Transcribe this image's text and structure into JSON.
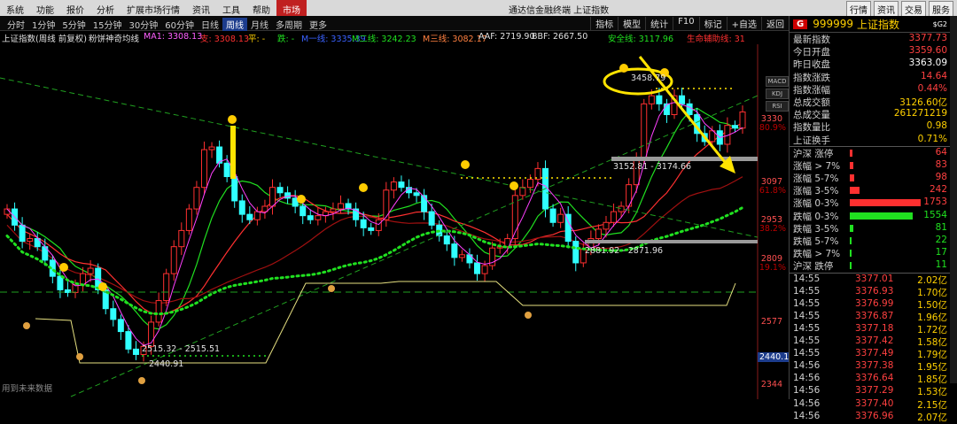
{
  "topbar": {
    "menu": [
      "系统",
      "功能",
      "报价",
      "分析",
      "扩展市场行情",
      "资讯",
      "工具",
      "帮助",
      "市场"
    ],
    "app_title": "通达信金融终端  上证指数",
    "right_buttons": [
      "行情",
      "资讯",
      "交易",
      "服务"
    ]
  },
  "periodbar": {
    "periods": [
      "分时",
      "1分钟",
      "5分钟",
      "15分钟",
      "30分钟",
      "60分钟",
      "日线",
      "周线",
      "月线",
      "多周期",
      "更多"
    ],
    "selected": "周线",
    "tools": [
      "指标",
      "模型",
      "统计",
      "F10",
      "标记",
      "+自选",
      "返回"
    ]
  },
  "indicators": {
    "title": "上证指数(周线 前复权)",
    "formula": "粉饼神奇均线",
    "ma1": "MA1: 3308.13",
    "items": [
      {
        "text": "支: 3308.13",
        "color": "#ff3030"
      },
      {
        "text": "平: -",
        "color": "#ffd000"
      },
      {
        "text": "跌: -",
        "color": "#20e020"
      },
      {
        "text": "M一线: 3335.39",
        "color": "#3a62ff"
      },
      {
        "text": "M二线: 3242.23",
        "color": "#20e020"
      },
      {
        "text": "M三线: 3082.17",
        "color": "#ff8040"
      },
      {
        "text": "AAF: 2719.90",
        "color": "#e0e0e0"
      },
      {
        "text": "BBF: 2667.50",
        "color": "#e0e0e0"
      },
      {
        "text": "安全线: 3117.96",
        "color": "#20e020"
      },
      {
        "text": "生命辅助线: 31",
        "color": "#ff3030"
      }
    ]
  },
  "chart_data": {
    "type": "candlestick",
    "symbol": "999999 上证指数",
    "period": "周线",
    "y_axis_labels": [
      "3330",
      "3097",
      "2953",
      "2809",
      "2577",
      "2344"
    ],
    "y_axis_percents": [
      "80.9%",
      "61.8%",
      "38.2%",
      "19.1%"
    ],
    "price_range": [
      2340,
      3460
    ],
    "last_price_tag": "2440.1",
    "annotations": {
      "high": "3458.79",
      "low": "2440.91",
      "zone_high": "3152.81 - 3174.66",
      "zone_mid": "2881.92 - 2871.96",
      "zone_low": "2515.32 - 2515.51"
    },
    "weekly_closes": [
      3000,
      2940,
      2880,
      2890,
      2860,
      2810,
      2750,
      2700,
      2690,
      2720,
      2760,
      2780,
      2700,
      2630,
      2590,
      2545,
      2480,
      2460,
      2490,
      2580,
      2660,
      2760,
      2860,
      2920,
      3000,
      3080,
      3220,
      3230,
      3170,
      3120,
      3030,
      2980,
      2960,
      2990,
      3010,
      3080,
      3060,
      3040,
      3010,
      2975,
      2960,
      2975,
      2990,
      3000,
      3020,
      3000,
      2960,
      2930,
      2920,
      2960,
      3070,
      3100,
      3080,
      3060,
      3050,
      2990,
      2940,
      2900,
      2870,
      2820,
      2830,
      2800,
      2760,
      2790,
      2855,
      2860,
      2890,
      3050,
      3080,
      3110,
      3150,
      3000,
      2950,
      2980,
      2880,
      2800,
      2850,
      2890,
      2925,
      2950,
      2990,
      3010,
      3090,
      3180,
      3390,
      3420,
      3390,
      3350,
      3420,
      3390,
      3350,
      3280,
      3250,
      3290,
      3240,
      3310,
      3300,
      3360
    ]
  },
  "footer_note": "用到未来数据",
  "quote": {
    "code": "999999",
    "name": "上证指数",
    "tag": "$G2",
    "fields": [
      {
        "label": "最新指数",
        "value": "3377.73",
        "color": "red"
      },
      {
        "label": "今日开盘",
        "value": "3359.60",
        "color": "red"
      },
      {
        "label": "昨日收盘",
        "value": "3363.09",
        "color": "white"
      },
      {
        "label": "指数涨跌",
        "value": "14.64",
        "color": "red"
      },
      {
        "label": "指数涨幅",
        "value": "0.44%",
        "color": "red"
      },
      {
        "label": "总成交额",
        "value": "3126.60亿",
        "color": "yellow"
      },
      {
        "label": "总成交量",
        "value": "261271219",
        "color": "yellow"
      },
      {
        "label": "指数量比",
        "value": "0.98",
        "color": "yellow"
      },
      {
        "label": "上证换手",
        "value": "0.71%",
        "color": "yellow"
      }
    ],
    "breadth": [
      {
        "label": "沪深 涨停",
        "count": "64",
        "color": "red",
        "frac": 0.04
      },
      {
        "label": "涨幅 > 7%",
        "count": "83",
        "color": "red",
        "frac": 0.05
      },
      {
        "label": "涨幅 5-7%",
        "count": "98",
        "color": "red",
        "frac": 0.06
      },
      {
        "label": "涨幅 3-5%",
        "count": "242",
        "color": "red",
        "frac": 0.14
      },
      {
        "label": "涨幅 0-3%",
        "count": "1753",
        "color": "red",
        "frac": 1.0
      },
      {
        "label": "跌幅 0-3%",
        "count": "1554",
        "color": "green",
        "frac": 0.89
      },
      {
        "label": "跌幅 3-5%",
        "count": "81",
        "color": "green",
        "frac": 0.05
      },
      {
        "label": "跌幅 5-7%",
        "count": "22",
        "color": "green",
        "frac": 0.02
      },
      {
        "label": "跌幅 > 7%",
        "count": "17",
        "color": "green",
        "frac": 0.01
      },
      {
        "label": "沪深 跌停",
        "count": "11",
        "color": "green",
        "frac": 0.01
      }
    ],
    "ticks": [
      {
        "time": "14:55",
        "price": "3377.01",
        "vol": "2.02亿"
      },
      {
        "time": "14:55",
        "price": "3376.93",
        "vol": "1.70亿"
      },
      {
        "time": "14:55",
        "price": "3376.99",
        "vol": "1.50亿"
      },
      {
        "time": "14:55",
        "price": "3376.87",
        "vol": "1.96亿"
      },
      {
        "time": "14:55",
        "price": "3377.18",
        "vol": "1.72亿"
      },
      {
        "time": "14:55",
        "price": "3377.42",
        "vol": "1.58亿"
      },
      {
        "time": "14:55",
        "price": "3377.49",
        "vol": "1.79亿"
      },
      {
        "time": "14:56",
        "price": "3377.38",
        "vol": "1.95亿"
      },
      {
        "time": "14:56",
        "price": "3376.64",
        "vol": "1.85亿"
      },
      {
        "time": "14:56",
        "price": "3377.29",
        "vol": "1.53亿"
      },
      {
        "time": "14:56",
        "price": "3377.40",
        "vol": "2.15亿"
      },
      {
        "time": "14:56",
        "price": "3376.96",
        "vol": "2.07亿"
      }
    ]
  }
}
